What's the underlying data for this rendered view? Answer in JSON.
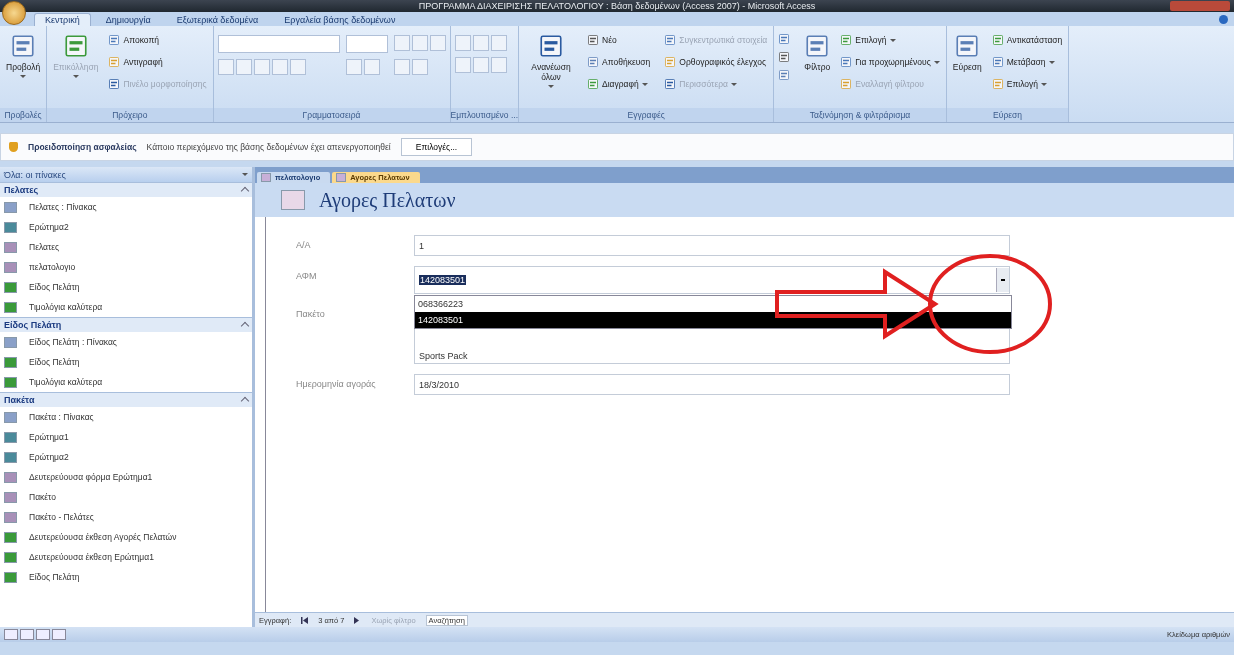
{
  "window": {
    "title": "ΠΡΟΓΡΑΜΜΑ ΔΙΑΧΕΙΡΙΣΗΣ ΠΕΛΑΤΟΛΟΓΙΟΥ : Βάση δεδομένων (Access 2007) - Microsoft Access"
  },
  "ribbon": {
    "tabs": [
      {
        "label": "Κεντρική",
        "selected": true
      },
      {
        "label": "Δημιουργία",
        "selected": false
      },
      {
        "label": "Εξωτερικά δεδομένα",
        "selected": false
      },
      {
        "label": "Εργαλεία βάσης δεδομένων",
        "selected": false
      }
    ],
    "groups": [
      {
        "label": "Προβολές",
        "items": [
          {
            "kind": "large",
            "label": "Προβολή",
            "disabled": false,
            "menu": true
          }
        ]
      },
      {
        "label": "Πρόχειρο",
        "items": [
          {
            "kind": "large",
            "label": "Επικόλληση",
            "disabled": true,
            "menu": true
          },
          {
            "kind": "small",
            "label": "Αποκοπή",
            "disabled": false,
            "menu": false
          },
          {
            "kind": "small",
            "label": "Αντιγραφή",
            "disabled": false,
            "menu": false
          },
          {
            "kind": "small",
            "label": "Πινέλο μορφοποίησης",
            "disabled": true,
            "menu": false
          }
        ]
      },
      {
        "label": "Γραμματοσειρά",
        "items": [
          {
            "kind": "font"
          }
        ]
      },
      {
        "label": "Εμπλουτισμένο ...",
        "items": [
          {
            "kind": "paragraph"
          }
        ]
      },
      {
        "label": "Εγγραφές",
        "items": [
          {
            "kind": "large",
            "label": "Ανανέωση όλων",
            "disabled": false,
            "menu": true
          },
          {
            "kind": "small",
            "label": "Νέο",
            "disabled": false,
            "menu": false
          },
          {
            "kind": "small",
            "label": "Αποθήκευση",
            "disabled": false,
            "menu": false
          },
          {
            "kind": "small",
            "label": "Διαγραφή",
            "disabled": false,
            "menu": true
          },
          {
            "kind": "small",
            "label": "Συγκεντρωτικά στοιχεία",
            "disabled": true,
            "menu": false
          },
          {
            "kind": "small",
            "label": "Ορθογραφικός έλεγχος",
            "disabled": false,
            "menu": false
          },
          {
            "kind": "small",
            "label": "Περισσότερα",
            "disabled": true,
            "menu": true
          }
        ]
      },
      {
        "label": "Ταξινόμηση & φιλτράρισμα",
        "items": [
          {
            "kind": "sort"
          },
          {
            "kind": "large",
            "label": "Φίλτρο",
            "disabled": false,
            "menu": false
          },
          {
            "kind": "small",
            "label": "Επιλογή",
            "disabled": false,
            "menu": true
          },
          {
            "kind": "small",
            "label": "Για προχωρημένους",
            "disabled": false,
            "menu": true
          },
          {
            "kind": "small",
            "label": "Εναλλαγή φίλτρου",
            "disabled": true,
            "menu": false
          }
        ]
      },
      {
        "label": "Εύρεση",
        "items": [
          {
            "kind": "large",
            "label": "Εύρεση",
            "disabled": false,
            "menu": false
          },
          {
            "kind": "small",
            "label": "Αντικατάσταση",
            "disabled": false,
            "menu": false
          },
          {
            "kind": "small",
            "label": "Μετάβαση",
            "disabled": false,
            "menu": true
          },
          {
            "kind": "small",
            "label": "Επιλογή",
            "disabled": false,
            "menu": true
          }
        ]
      }
    ]
  },
  "security_bar": {
    "title": "Προειδοποίηση ασφαλείας",
    "message": "Κάποιο περιεχόμενο της βάσης δεδομένων έχει απενεργοποιηθεί",
    "button": "Επιλογές..."
  },
  "navigation": {
    "header": "Όλα: οι πίνακες",
    "groups": [
      {
        "label": "Πελατες",
        "items": [
          {
            "kind": "table",
            "label": "Πελατες : Πίνακας"
          },
          {
            "kind": "query",
            "label": "Ερώτημα2"
          },
          {
            "kind": "form",
            "label": "Πελατες"
          },
          {
            "kind": "form",
            "label": "πελατολογιο"
          },
          {
            "kind": "report",
            "label": "Είδος Πελάτη"
          },
          {
            "kind": "report",
            "label": "Τιμολόγια καλύτερα"
          }
        ]
      },
      {
        "label": "Είδος Πελάτη",
        "items": [
          {
            "kind": "table",
            "label": "Είδος Πελάτη : Πίνακας"
          },
          {
            "kind": "report",
            "label": "Είδος Πελάτη"
          },
          {
            "kind": "report",
            "label": "Τιμολόγια καλύτερα"
          }
        ]
      },
      {
        "label": "Πακέτα",
        "items": [
          {
            "kind": "table",
            "label": "Πακέτα : Πίνακας"
          },
          {
            "kind": "query",
            "label": "Ερώτημα1"
          },
          {
            "kind": "query",
            "label": "Ερώτημα2"
          },
          {
            "kind": "form",
            "label": "Δευτερεύουσα φόρμα Ερώτημα1"
          },
          {
            "kind": "form",
            "label": "Πακέτο"
          },
          {
            "kind": "form",
            "label": "Πακέτο - Πελάτες"
          },
          {
            "kind": "report",
            "label": "Δευτερεύουσα έκθεση Αγορές Πελατών"
          },
          {
            "kind": "report",
            "label": "Δευτερεύουσα έκθεση Ερώτημα1"
          },
          {
            "kind": "report",
            "label": "Είδος Πελάτη"
          }
        ]
      }
    ]
  },
  "document_tabs": [
    {
      "label": "πελατολογιο",
      "selected": false
    },
    {
      "label": "Αγορες Πελατων",
      "selected": true
    }
  ],
  "form": {
    "title": "Αγορες Πελατων",
    "fields": [
      {
        "kind": "text",
        "label": "Α/Α",
        "value": "1"
      },
      {
        "kind": "combo",
        "label": "ΑΦΜ",
        "value": "142083501",
        "dropdown": [
          {
            "label": "068366223",
            "selected": false
          },
          {
            "label": "142083501",
            "selected": true
          }
        ]
      },
      {
        "kind": "list",
        "label": "Πακέτο",
        "options": [
          "Sports Pack"
        ]
      },
      {
        "kind": "text",
        "label": "Ημερομηνία αγοράς",
        "value": "18/3/2010"
      }
    ]
  },
  "record_navigator": {
    "label": "Εγγραφή:",
    "position": "3 από 7",
    "filter": "Χωρίς φίλτρο",
    "search": "Αναζήτηση"
  },
  "status_bar": {
    "text": "Κλείδωμα αριθμών"
  }
}
